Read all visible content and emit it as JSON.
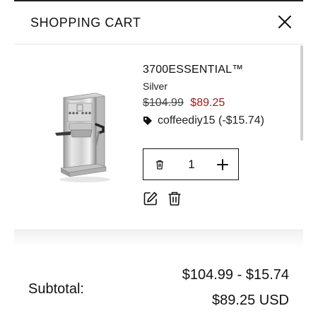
{
  "header": {
    "title": "SHOPPING CART",
    "close_icon": "close-icon"
  },
  "item": {
    "image_icon": "espresso-machine-image",
    "name": "3700ESSENTIAL™",
    "variant": "Silver",
    "price_original": "$104.99",
    "price_sale": "$89.25",
    "discount_icon": "tag-icon",
    "discount_code": "coffeediy15 (-$15.74)",
    "quantity": {
      "remove_icon": "trash-icon",
      "value": "1",
      "increment_icon": "plus-icon"
    },
    "actions": {
      "edit_icon": "edit-icon",
      "delete_icon": "trash-icon"
    }
  },
  "footer": {
    "subtotal_label": "Subtotal:",
    "subtotal_calculation": "$104.99 - $15.74",
    "subtotal_total": "$89.25 USD"
  },
  "colors": {
    "sale_price": "#9a1b1b",
    "text": "#111111",
    "divider": "#e6e6e6"
  }
}
